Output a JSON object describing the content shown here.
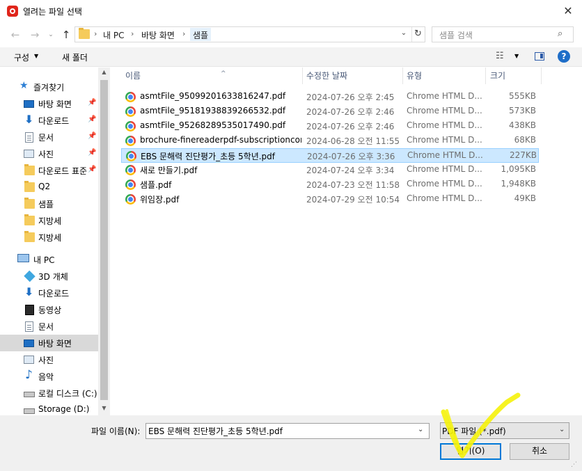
{
  "window": {
    "title": "열려는 파일 선택",
    "close_label": "✕"
  },
  "address": {
    "crumbs": [
      "내 PC",
      "바탕 화면",
      "샘플"
    ],
    "search_placeholder": "샘플 검색"
  },
  "toolbar": {
    "organize_label": "구성",
    "new_folder_label": "새 폴더"
  },
  "sidebar": {
    "items": [
      {
        "label": "즐겨찾기",
        "icon": "star-icon",
        "pinned": false
      },
      {
        "label": "바탕 화면",
        "icon": "desktop-icon",
        "pinned": true
      },
      {
        "label": "다운로드",
        "icon": "download-icon",
        "pinned": true
      },
      {
        "label": "문서",
        "icon": "document-icon",
        "pinned": true
      },
      {
        "label": "사진",
        "icon": "picture-icon",
        "pinned": true
      },
      {
        "label": "다운로드 표준",
        "icon": "folder-icon",
        "pinned": true
      },
      {
        "label": "Q2",
        "icon": "folder-icon",
        "pinned": false
      },
      {
        "label": "샘플",
        "icon": "folder-icon",
        "pinned": false
      },
      {
        "label": "지방세",
        "icon": "folder-icon",
        "pinned": false
      },
      {
        "label": "지방세",
        "icon": "folder-icon",
        "pinned": false
      },
      {
        "label": "내 PC",
        "icon": "computer-icon",
        "pinned": false
      },
      {
        "label": "3D 개체",
        "icon": "3d-objects-icon",
        "pinned": false
      },
      {
        "label": "다운로드",
        "icon": "download-icon",
        "pinned": false
      },
      {
        "label": "동영상",
        "icon": "video-icon",
        "pinned": false
      },
      {
        "label": "문서",
        "icon": "document-icon",
        "pinned": false
      },
      {
        "label": "바탕 화면",
        "icon": "desktop-icon",
        "pinned": false,
        "selected": true
      },
      {
        "label": "사진",
        "icon": "picture-icon",
        "pinned": false
      },
      {
        "label": "음악",
        "icon": "music-icon",
        "pinned": false
      },
      {
        "label": "로컬 디스크 (C:)",
        "icon": "local-disk-icon",
        "pinned": false
      },
      {
        "label": "Storage (D:)",
        "icon": "drive-icon",
        "pinned": false
      }
    ]
  },
  "columns": {
    "name": "이름",
    "date": "수정한 날짜",
    "type": "유형",
    "size": "크기"
  },
  "files": [
    {
      "name": "asmtFile_95099201633816247.pdf",
      "date": "2024-07-26 오후 2:45",
      "type": "Chrome HTML D...",
      "size": "555KB"
    },
    {
      "name": "asmtFile_95181938839266532.pdf",
      "date": "2024-07-26 오후 2:46",
      "type": "Chrome HTML D...",
      "size": "573KB"
    },
    {
      "name": "asmtFile_95268289535017490.pdf",
      "date": "2024-07-26 오후 2:46",
      "type": "Chrome HTML D...",
      "size": "438KB"
    },
    {
      "name": "brochure-finereaderpdf-subscriptioncon...",
      "date": "2024-06-28 오전 11:55",
      "type": "Chrome HTML D...",
      "size": "68KB"
    },
    {
      "name": "EBS 문해력 진단평가_초등 5학년.pdf",
      "date": "2024-07-26 오후 3:36",
      "type": "Chrome HTML D...",
      "size": "227KB",
      "selected": true
    },
    {
      "name": "새로 만들기.pdf",
      "date": "2024-07-24 오후 3:34",
      "type": "Chrome HTML D...",
      "size": "1,095KB"
    },
    {
      "name": "샘플.pdf",
      "date": "2024-07-23 오전 11:58",
      "type": "Chrome HTML D...",
      "size": "1,948KB"
    },
    {
      "name": "위임장.pdf",
      "date": "2024-07-29 오전 10:54",
      "type": "Chrome HTML D...",
      "size": "49KB"
    }
  ],
  "bottom": {
    "filename_label": "파일 이름(N):",
    "filename_value": "EBS 문해력 진단평가_초등 5학년.pdf",
    "filter_value": "PDF 파일 (*.pdf)",
    "open_label": "열기(O)",
    "cancel_label": "취소"
  },
  "colors": {
    "selection": "#cce8ff",
    "accent": "#0078d7",
    "annotation": "#f5f20a"
  }
}
